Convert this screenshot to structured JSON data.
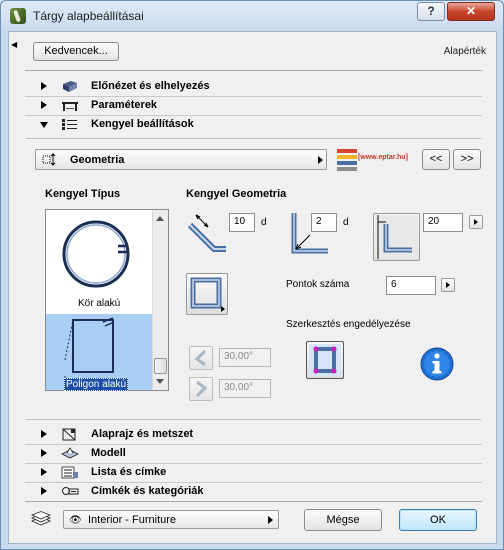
{
  "window": {
    "title": "Tárgy alapbeállításai",
    "help_label": "?",
    "close_label": "✕"
  },
  "header": {
    "favorites_label": "Kedvencek...",
    "default_label": "Alapérték"
  },
  "sections_top": [
    {
      "label": "Előnézet és elhelyezés",
      "expanded": false,
      "icon": "preview-icon"
    },
    {
      "label": "Paraméterek",
      "expanded": false,
      "icon": "parameters-icon"
    },
    {
      "label": "Kengyel beállítások",
      "expanded": true,
      "icon": "stirrup-settings-icon"
    }
  ],
  "panel": {
    "geometry_popup_label": "Geometria",
    "logo_text": "[www.eptar.hu]",
    "prev_label": "<<",
    "next_label": ">>",
    "type_heading": "Kengyel Típus",
    "geometry_heading": "Kengyel Geometria",
    "type_items": [
      {
        "label": "Kör alakú",
        "selected": false
      },
      {
        "label": "Poligon alakú",
        "selected": true
      }
    ],
    "hook_length": "10",
    "hook_unit": "d",
    "bend_diameter": "2",
    "bend_unit": "d",
    "cover_value": "20",
    "points_label": "Pontok száma",
    "points_value": "6",
    "edit_enable_label": "Szerkesztés engedélyezése",
    "angle1": "30,00°",
    "angle2": "30,00°"
  },
  "sections_bottom": [
    {
      "label": "Alaprajz és metszet",
      "icon": "floorplan-icon"
    },
    {
      "label": "Modell",
      "icon": "model-icon"
    },
    {
      "label": "Lista és címke",
      "icon": "list-icon"
    },
    {
      "label": "Címkék és kategóriák",
      "icon": "tags-icon"
    }
  ],
  "footer": {
    "layer_label": "Interior - Furniture",
    "cancel_label": "Mégse",
    "ok_label": "OK"
  },
  "colors": {
    "selection": "#a8cef5",
    "accent_blue": "#1c4fa8",
    "info_blue": "#1d6fd1",
    "bar_color": "#4a6fa5",
    "edit_magenta": "#d11cc0"
  }
}
